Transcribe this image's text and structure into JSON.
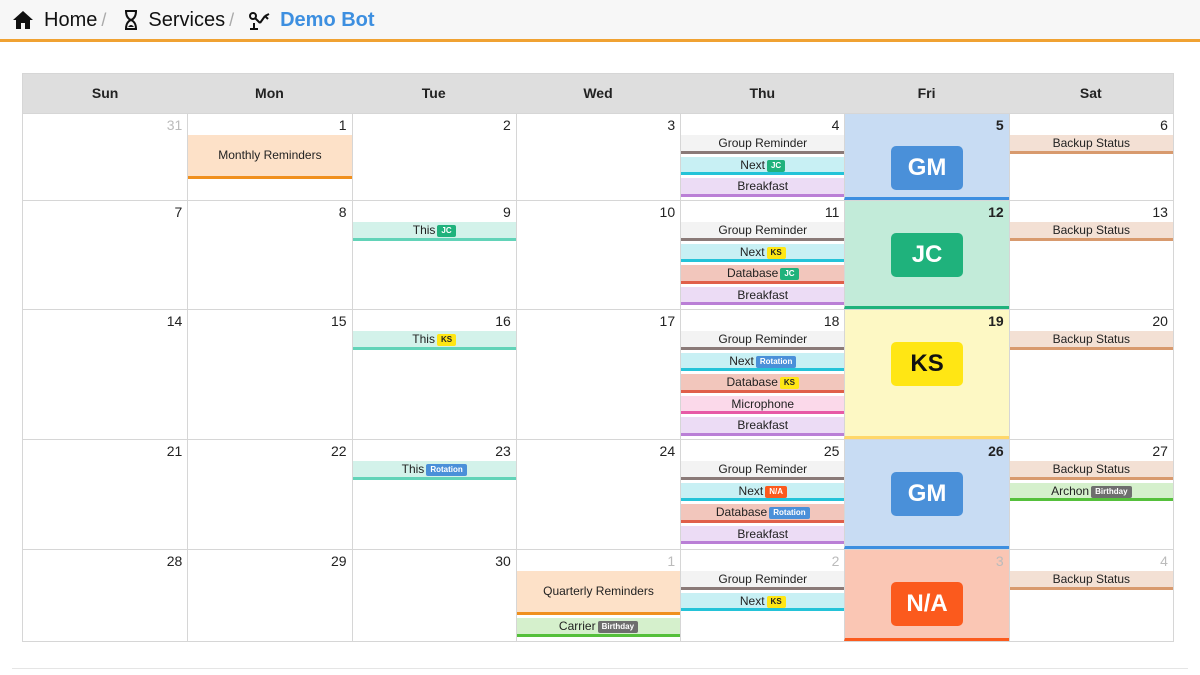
{
  "breadcrumb": [
    {
      "label": "Home",
      "icon": "home-icon",
      "active": false
    },
    {
      "label": "Services",
      "icon": "hourglass-icon",
      "active": false
    },
    {
      "label": "Demo Bot",
      "icon": "robot-arm-icon",
      "active": true
    }
  ],
  "breadcrumb_separator": "/",
  "colors": {
    "accent": "#f0a232",
    "link": "#3d8fe0"
  },
  "calendar": {
    "days_of_week": [
      "Sun",
      "Mon",
      "Tue",
      "Wed",
      "Thu",
      "Fri",
      "Sat"
    ],
    "weeks": [
      [
        {
          "day": "31",
          "other": true,
          "events": []
        },
        {
          "day": "1",
          "events": [
            {
              "title": "Monthly Reminders",
              "kind": "monthly",
              "tall": true
            }
          ]
        },
        {
          "day": "2",
          "events": []
        },
        {
          "day": "3",
          "events": []
        },
        {
          "day": "4",
          "events": [
            {
              "title": "Group Reminder",
              "kind": "grp"
            },
            {
              "title": "Next",
              "kind": "next",
              "tag": "JC",
              "tag_kind": "t-jc"
            },
            {
              "title": "Breakfast",
              "kind": "bfast"
            }
          ]
        },
        {
          "day": "5",
          "bold": true,
          "oncall": "GM",
          "oncall_kind": "oc-gm",
          "events": []
        },
        {
          "day": "6",
          "events": [
            {
              "title": "Backup Status",
              "kind": "backup"
            }
          ]
        }
      ],
      [
        {
          "day": "7",
          "events": []
        },
        {
          "day": "8",
          "events": []
        },
        {
          "day": "9",
          "events": [
            {
              "title": "This",
              "kind": "this",
              "tag": "JC",
              "tag_kind": "t-jc"
            }
          ]
        },
        {
          "day": "10",
          "events": []
        },
        {
          "day": "11",
          "events": [
            {
              "title": "Group Reminder",
              "kind": "grp"
            },
            {
              "title": "Next",
              "kind": "next",
              "tag": "KS",
              "tag_kind": "t-ks"
            },
            {
              "title": "Database",
              "kind": "db",
              "tag": "JC",
              "tag_kind": "t-jc"
            },
            {
              "title": "Breakfast",
              "kind": "bfast"
            }
          ]
        },
        {
          "day": "12",
          "bold": true,
          "oncall": "JC",
          "oncall_kind": "oc-jc",
          "events": []
        },
        {
          "day": "13",
          "events": [
            {
              "title": "Backup Status",
              "kind": "backup"
            }
          ]
        }
      ],
      [
        {
          "day": "14",
          "events": []
        },
        {
          "day": "15",
          "events": []
        },
        {
          "day": "16",
          "events": [
            {
              "title": "This",
              "kind": "this",
              "tag": "KS",
              "tag_kind": "t-ks"
            }
          ]
        },
        {
          "day": "17",
          "events": []
        },
        {
          "day": "18",
          "events": [
            {
              "title": "Group Reminder",
              "kind": "grp"
            },
            {
              "title": "Next",
              "kind": "next",
              "tag": "Rotation",
              "tag_kind": "t-rot"
            },
            {
              "title": "Database",
              "kind": "db",
              "tag": "KS",
              "tag_kind": "t-ks"
            },
            {
              "title": "Microphone",
              "kind": "mic"
            },
            {
              "title": "Breakfast",
              "kind": "bfast"
            }
          ]
        },
        {
          "day": "19",
          "bold": true,
          "oncall": "KS",
          "oncall_kind": "oc-ks",
          "events": []
        },
        {
          "day": "20",
          "events": [
            {
              "title": "Backup Status",
              "kind": "backup"
            }
          ]
        }
      ],
      [
        {
          "day": "21",
          "events": []
        },
        {
          "day": "22",
          "events": []
        },
        {
          "day": "23",
          "events": [
            {
              "title": "This",
              "kind": "this",
              "tag": "Rotation",
              "tag_kind": "t-rot"
            }
          ]
        },
        {
          "day": "24",
          "events": []
        },
        {
          "day": "25",
          "events": [
            {
              "title": "Group Reminder",
              "kind": "grp"
            },
            {
              "title": "Next",
              "kind": "next",
              "tag": "N/A",
              "tag_kind": "t-na"
            },
            {
              "title": "Database",
              "kind": "db",
              "tag": "Rotation",
              "tag_kind": "t-rot"
            },
            {
              "title": "Breakfast",
              "kind": "bfast"
            }
          ]
        },
        {
          "day": "26",
          "bold": true,
          "oncall": "GM",
          "oncall_kind": "oc-gm",
          "events": []
        },
        {
          "day": "27",
          "events": [
            {
              "title": "Backup Status",
              "kind": "backup"
            },
            {
              "title": "Archon",
              "kind": "bday",
              "tag": "Birthday",
              "tag_kind": "t-bd"
            }
          ]
        }
      ],
      [
        {
          "day": "28",
          "events": []
        },
        {
          "day": "29",
          "events": []
        },
        {
          "day": "30",
          "events": []
        },
        {
          "day": "1",
          "other": true,
          "events": [
            {
              "title": "Quarterly Reminders",
              "kind": "monthly",
              "tall": true
            },
            {
              "title": "Carrier",
              "kind": "bday",
              "tag": "Birthday",
              "tag_kind": "t-bd"
            }
          ]
        },
        {
          "day": "2",
          "other": true,
          "events": [
            {
              "title": "Group Reminder",
              "kind": "grp"
            },
            {
              "title": "Next",
              "kind": "next",
              "tag": "KS",
              "tag_kind": "t-ks"
            }
          ]
        },
        {
          "day": "3",
          "other": true,
          "oncall": "N/A",
          "oncall_kind": "oc-na",
          "events": []
        },
        {
          "day": "4",
          "other": true,
          "events": [
            {
              "title": "Backup Status",
              "kind": "backup"
            }
          ]
        }
      ]
    ]
  }
}
